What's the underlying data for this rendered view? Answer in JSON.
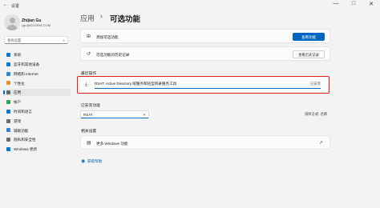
{
  "window": {
    "title": "设置",
    "minimize": "—",
    "maximize": "□",
    "close": "✕"
  },
  "user": {
    "name": "Zhijian Gu",
    "email": "zgu@GLORIA.COM"
  },
  "search": {
    "placeholder": "查找设置"
  },
  "nav": [
    {
      "label": "系统",
      "icon": "monitor-icon",
      "color": "#0078d4"
    },
    {
      "label": "蓝牙和其他设备",
      "icon": "bluetooth-icon",
      "color": "#0078d4"
    },
    {
      "label": "网络和 Internet",
      "icon": "network-icon",
      "color": "#2b88d8"
    },
    {
      "label": "个性化",
      "icon": "brush-icon",
      "color": "#e8913a"
    },
    {
      "label": "应用",
      "icon": "apps-icon",
      "color": "#5c6b7a"
    },
    {
      "label": "帐户",
      "icon": "account-icon",
      "color": "#2da44e"
    },
    {
      "label": "时间和语言",
      "icon": "globe-clock-icon",
      "color": "#0078d4"
    },
    {
      "label": "游戏",
      "icon": "gamepad-icon",
      "color": "#6b6b6b"
    },
    {
      "label": "辅助功能",
      "icon": "accessibility-icon",
      "color": "#3a7bd5"
    },
    {
      "label": "隐私和安全性",
      "icon": "shield-icon",
      "color": "#6b6b6b"
    },
    {
      "label": "Windows 更新",
      "icon": "update-icon",
      "color": "#0078d4"
    }
  ],
  "breadcrumb": {
    "parent": "应用",
    "separator": "›",
    "current": "可选功能"
  },
  "add_feature": {
    "label": "添加可选功能",
    "button": "查看功能"
  },
  "history": {
    "label": "可选功能的历史记录",
    "button": "查看历史记录"
  },
  "recent": {
    "heading": "最近操作",
    "item": {
      "label": "RSAT: Active Directory 域服务和轻型目录服务工具",
      "status": "已安装",
      "progress": 1.0
    }
  },
  "installed": {
    "heading": "已安装功能",
    "filter_value": "RSAT",
    "clear_icon": "✕",
    "sort_label": "排序方式: 名称"
  },
  "related": {
    "heading": "相关设置",
    "more_features": "更多 Windows 功能"
  },
  "help": {
    "label": "获取帮助"
  },
  "accent": "#0067c0",
  "highlight_color": "#e0201b"
}
